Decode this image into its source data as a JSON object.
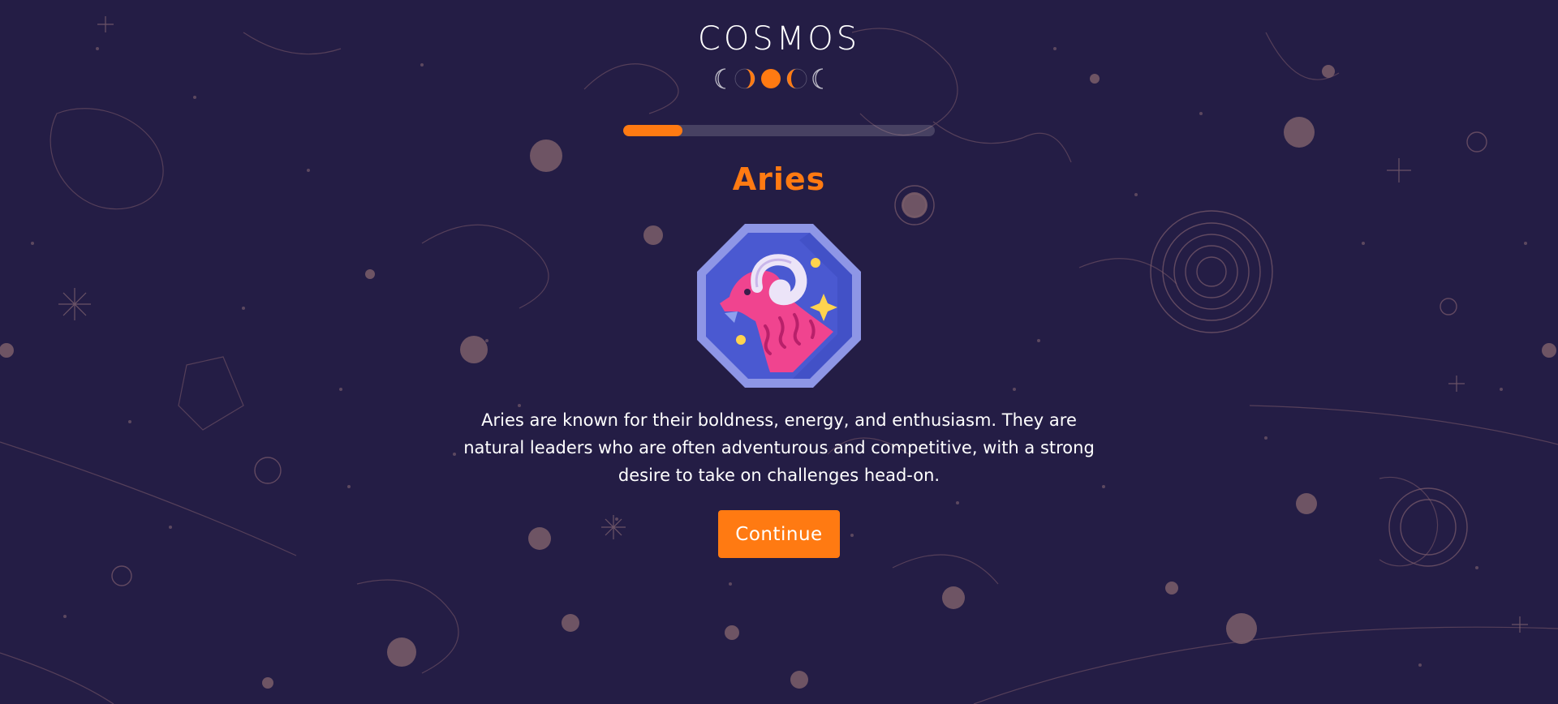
{
  "app": {
    "logo_text": "COSMOS",
    "logo_icon": "moon-phases-icon"
  },
  "progress": {
    "fraction": 0.19
  },
  "sign": {
    "title": "Aries",
    "icon": "aries-ram-icon",
    "description": "Aries are known for their boldness, energy, and enthusiasm. They are natural leaders who are often adventurous and competitive, with a strong desire to take on challenges head-on."
  },
  "actions": {
    "continue_label": "Continue"
  },
  "colors": {
    "background": "#241d45",
    "accent": "#ff7a12",
    "text": "#ffffff",
    "emblem_frame": "#8e96e6",
    "emblem_fill": "#4a59d1",
    "ram_body": "#f0448f"
  }
}
